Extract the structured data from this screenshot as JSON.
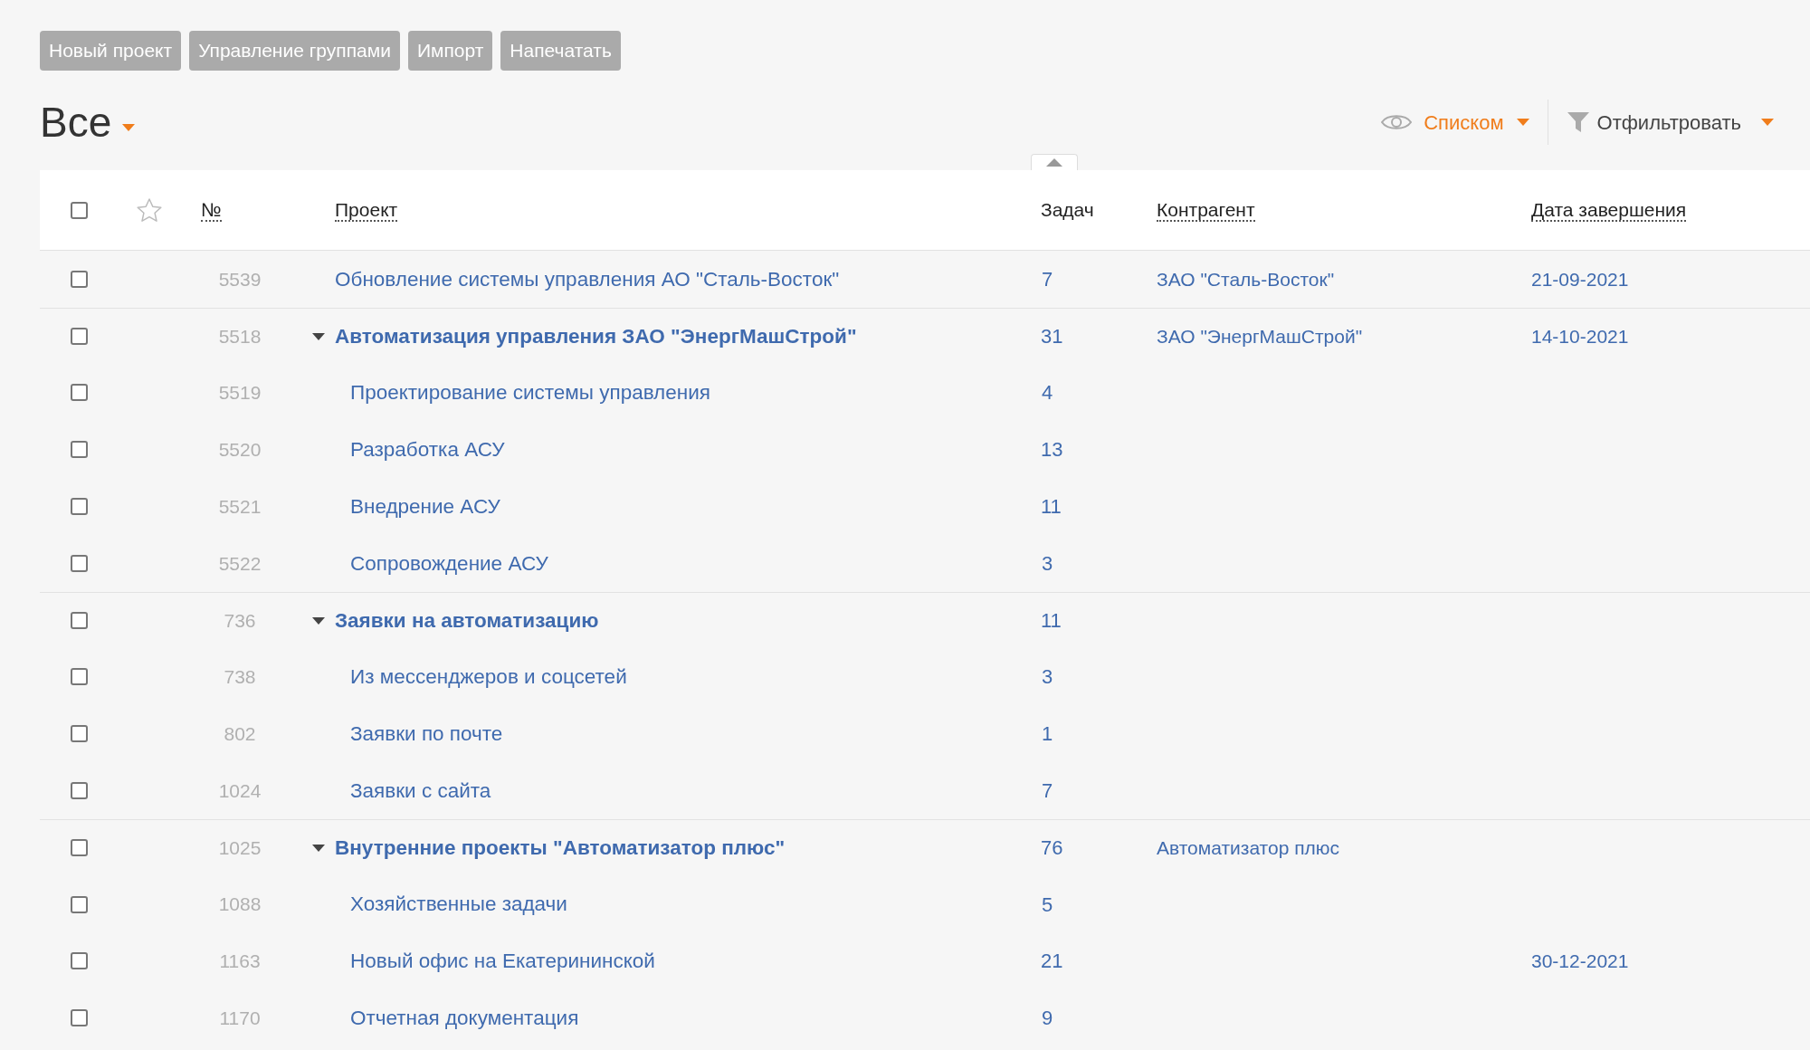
{
  "toolbar": {
    "buttons": [
      "Новый проект",
      "Управление группами",
      "Импорт",
      "Напечатать"
    ]
  },
  "view": {
    "title": "Все",
    "mode": "Списком",
    "filter": "Отфильтровать"
  },
  "table": {
    "select_all_checked": false,
    "columns": [
      {
        "label": "№",
        "sortable": true
      },
      {
        "label": "Проект",
        "sortable": true
      },
      {
        "label": "Задач",
        "sortable": false
      },
      {
        "label": "Контрагент",
        "sortable": true
      },
      {
        "label": "Дата завершения",
        "sortable": true
      }
    ],
    "rows": [
      {
        "checked": false,
        "number": "5539",
        "project": "Обновление системы управления АО \"Сталь-Восток\"",
        "tasks": "7",
        "counterparty": "ЗАО \"Сталь-Восток\"",
        "date": "21-09-2021"
      },
      {
        "checked": false,
        "number": "5518",
        "project": "Автоматизация управления ЗАО \"ЭнергМашСтрой\"",
        "tasks": "31",
        "counterparty": "ЗАО \"ЭнергМашСтрой\"",
        "date": "14-10-2021",
        "expanded": true,
        "children": [
          {
            "checked": false,
            "number": "5519",
            "project": "Проектирование системы управления",
            "tasks": "4"
          },
          {
            "checked": false,
            "number": "5520",
            "project": "Разработка АСУ",
            "tasks": "13"
          },
          {
            "checked": false,
            "number": "5521",
            "project": "Внедрение АСУ",
            "tasks": "11"
          },
          {
            "checked": false,
            "number": "5522",
            "project": "Сопровождение АСУ",
            "tasks": "3"
          }
        ]
      },
      {
        "checked": false,
        "number": "736",
        "project": "Заявки на автоматизацию",
        "tasks": "11",
        "expanded": true,
        "children": [
          {
            "checked": false,
            "number": "738",
            "project": "Из мессенджеров и соцсетей",
            "tasks": "3"
          },
          {
            "checked": false,
            "number": "802",
            "project": "Заявки по почте",
            "tasks": "1"
          },
          {
            "checked": false,
            "number": "1024",
            "project": "Заявки с сайта",
            "tasks": "7"
          }
        ]
      },
      {
        "checked": false,
        "number": "1025",
        "project": "Внутренние проекты \"Автоматизатор плюс\"",
        "tasks": "76",
        "counterparty": "Автоматизатор плюс",
        "expanded": true,
        "children": [
          {
            "checked": false,
            "number": "1088",
            "project": "Хозяйственные задачи",
            "tasks": "5"
          },
          {
            "checked": false,
            "number": "1163",
            "project": "Новый офис на Екатерининской",
            "tasks": "21",
            "date": "30-12-2021"
          },
          {
            "checked": false,
            "number": "1170",
            "project": "Отчетная документация",
            "tasks": "9"
          }
        ]
      }
    ]
  }
}
